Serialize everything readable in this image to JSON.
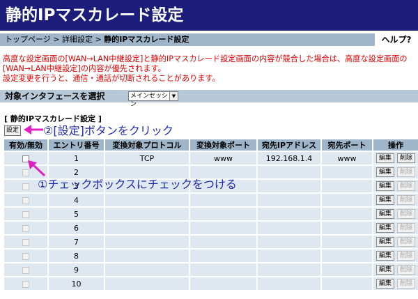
{
  "header": {
    "title": "静的IPマスカレード設定"
  },
  "breadcrumb": {
    "items": [
      "トップページ",
      "詳細設定"
    ],
    "separator": ">",
    "current": "静的IPマスカレード設定",
    "help": "ヘルプ?"
  },
  "warning": {
    "line1": "高度な設定画面の[WAN→LAN中継設定]と静的IPマスカレード設定画面の内容が競合した場合は、高度な設定画面の[WAN→LAN中継設定]の内容が優先されます。",
    "line2": "設定変更を行うと、通信・通話が切断されることがあります。",
    "color": "#e00000"
  },
  "interface": {
    "label": "対象インタフェースを選択",
    "selected": "メインセッション"
  },
  "section": {
    "title": "[ 静的IPマスカレード設定 ]",
    "set_button": "設定"
  },
  "annotations": {
    "step2": "②[設定]ボタンをクリック",
    "step1": "①チェックボックスにチェックをつける",
    "arrow_color": "#e020c0"
  },
  "table": {
    "headers": [
      "有効/無効",
      "エントリ番号",
      "変換対象プロトコル",
      "変換対象ポート",
      "宛先IPアドレス",
      "宛先ポート",
      "操作"
    ],
    "edit_label": "編集",
    "delete_label": "削除",
    "rows": [
      {
        "entry": "1",
        "protocol": "TCP",
        "port": "www",
        "ip": "192.168.1.4",
        "dest_port": "www",
        "enabled": true
      },
      {
        "entry": "2",
        "protocol": "",
        "port": "",
        "ip": "",
        "dest_port": "",
        "enabled": false
      },
      {
        "entry": "3",
        "protocol": "",
        "port": "",
        "ip": "",
        "dest_port": "",
        "enabled": false
      },
      {
        "entry": "4",
        "protocol": "",
        "port": "",
        "ip": "",
        "dest_port": "",
        "enabled": false
      },
      {
        "entry": "5",
        "protocol": "",
        "port": "",
        "ip": "",
        "dest_port": "",
        "enabled": false
      },
      {
        "entry": "6",
        "protocol": "",
        "port": "",
        "ip": "",
        "dest_port": "",
        "enabled": false
      },
      {
        "entry": "7",
        "protocol": "",
        "port": "",
        "ip": "",
        "dest_port": "",
        "enabled": false
      },
      {
        "entry": "8",
        "protocol": "",
        "port": "",
        "ip": "",
        "dest_port": "",
        "enabled": false
      },
      {
        "entry": "9",
        "protocol": "",
        "port": "",
        "ip": "",
        "dest_port": "",
        "enabled": false
      },
      {
        "entry": "10",
        "protocol": "",
        "port": "",
        "ip": "",
        "dest_port": "",
        "enabled": false
      }
    ]
  },
  "colors": {
    "title_bar": "#1c1c7a",
    "header_bar": "#9fb5c9",
    "row_bg": "#dfe7f0",
    "callout_text": "#1f2aa6"
  }
}
